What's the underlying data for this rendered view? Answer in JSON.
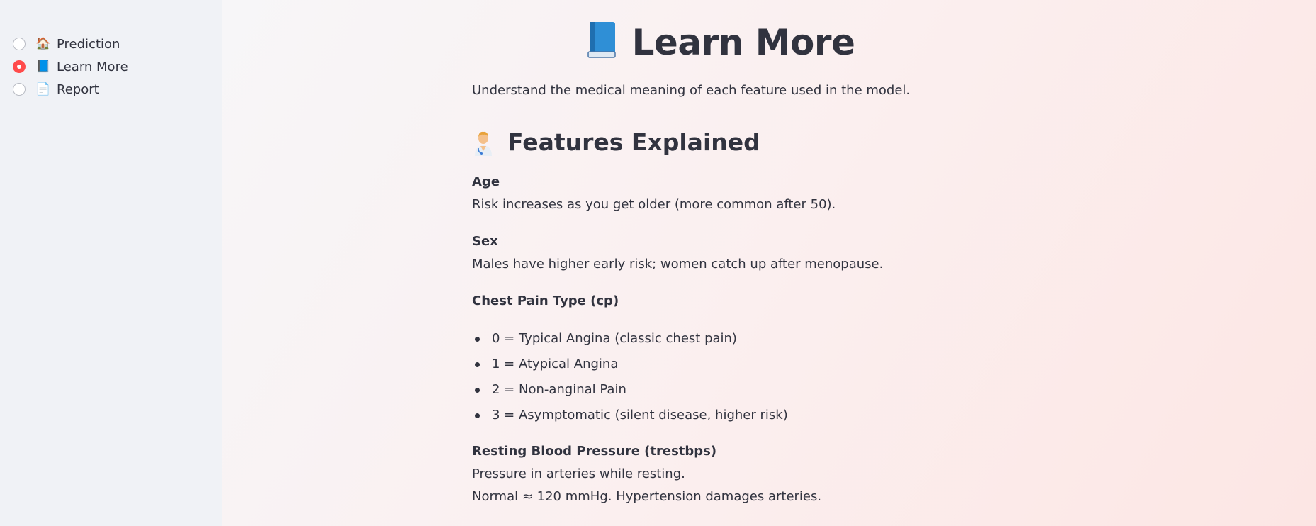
{
  "sidebar": {
    "items": [
      {
        "icon": "house-icon",
        "glyph": "🏠",
        "label": "Prediction",
        "selected": false
      },
      {
        "icon": "blue-book-icon",
        "glyph": "📘",
        "label": "Learn More",
        "selected": true
      },
      {
        "icon": "page-icon",
        "glyph": "📄",
        "label": "Report",
        "selected": false
      }
    ]
  },
  "main": {
    "title": "Learn More",
    "title_icon": "blue-book-icon",
    "intro": "Understand the medical meaning of each feature used in the model.",
    "section_title": "Features Explained",
    "section_icon": "doctor-icon",
    "features": {
      "age": {
        "title": "Age",
        "text": "Risk increases as you get older (more common after 50)."
      },
      "sex": {
        "title": "Sex",
        "text": "Males have higher early risk; women catch up after menopause."
      },
      "cp": {
        "title": "Chest Pain Type (cp)",
        "items": [
          "0 = Typical Angina (classic chest pain)",
          "1 = Atypical Angina",
          "2 = Non-anginal Pain",
          "3 = Asymptomatic (silent disease, higher risk)"
        ]
      },
      "trestbps": {
        "title": "Resting Blood Pressure (trestbps)",
        "line1": "Pressure in arteries while resting.",
        "line2": "Normal ≈ 120 mmHg. Hypertension damages arteries."
      }
    }
  },
  "colors": {
    "accent": "#ff4b4b",
    "text": "#31333f",
    "sidebar_bg": "#f0f2f6"
  }
}
